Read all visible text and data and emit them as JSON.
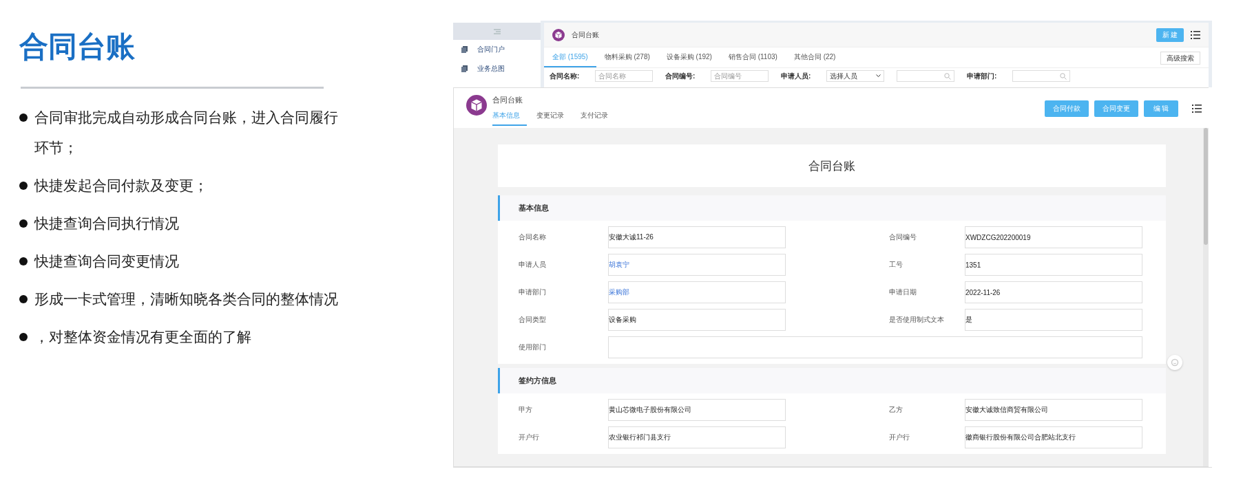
{
  "slide": {
    "title": "合同台账",
    "bullets": [
      {
        "text": "合同审批完成自动形成合同台账，进入合同履行环节；"
      },
      {
        "text": "快捷发起合同付款及变更；"
      },
      {
        "text": "快捷查询合同执行情况"
      },
      {
        "text": "快捷查询合同变更情况"
      },
      {
        "text": "形成一卡式管理，清晰知晓各类合同的整体情况"
      },
      {
        "text": "，对整体资金情况有更全面的了解"
      }
    ]
  },
  "background_app": {
    "sidebar": {
      "items": [
        {
          "label": "合同门户"
        },
        {
          "label": "业务总图"
        }
      ]
    },
    "title": "合同台账",
    "new_button": "新 建",
    "tabs": [
      {
        "label": "全部 (1595)",
        "selected": true
      },
      {
        "label": "物料采购 (278)",
        "selected": false
      },
      {
        "label": "设备采购 (192)",
        "selected": false
      },
      {
        "label": "销售合同 (1103)",
        "selected": false
      },
      {
        "label": "其他合同 (22)",
        "selected": false
      }
    ],
    "advanced_search": "高级搜索",
    "filters": [
      {
        "kind": "text",
        "label": "合同名称:",
        "placeholder": "合同名称"
      },
      {
        "kind": "text",
        "label": "合同编号:",
        "placeholder": "合同编号"
      },
      {
        "kind": "select",
        "label": "申请人员:",
        "value": "选择人员"
      },
      {
        "kind": "search"
      },
      {
        "kind": "search",
        "label": "申请部门:"
      }
    ]
  },
  "detail_window": {
    "title": "合同台账",
    "tabs": [
      {
        "label": "基本信息",
        "selected": true
      },
      {
        "label": "变更记录",
        "selected": false
      },
      {
        "label": "支付记录",
        "selected": false
      }
    ],
    "buttons": [
      "合同付款",
      "合同变更",
      "编 辑"
    ],
    "document_title": "合同台账",
    "sections": [
      {
        "title": "基本信息",
        "fields": [
          {
            "label": "合同名称",
            "value": "安徽大诚11-26",
            "link": false,
            "wide": false
          },
          {
            "label": "合同编号",
            "value": "XWDZCG202200019",
            "link": false,
            "wide": false
          },
          {
            "label": "申请人员",
            "value": "胡袁宁",
            "link": true,
            "wide": false
          },
          {
            "label": "工号",
            "value": "1351",
            "link": false,
            "wide": false
          },
          {
            "label": "申请部门",
            "value": "采购部",
            "link": true,
            "wide": false
          },
          {
            "label": "申请日期",
            "value": "2022-11-26",
            "link": false,
            "wide": false
          },
          {
            "label": "合同类型",
            "value": "设备采购",
            "link": false,
            "wide": false
          },
          {
            "label": "是否使用制式文本",
            "value": "是",
            "link": false,
            "wide": false
          },
          {
            "label": "使用部门",
            "link": false,
            "wide": true
          }
        ]
      },
      {
        "title": "签约方信息",
        "fields": [
          {
            "label": "甲方",
            "value": "黄山芯微电子股份有限公司",
            "link": false,
            "wide": false
          },
          {
            "label": "乙方",
            "value": "安徽大诚致信商贸有限公司",
            "link": false,
            "wide": false
          },
          {
            "label": "开户行",
            "value": "农业银行祁门县支行",
            "link": false,
            "wide": false
          },
          {
            "label": "开户行",
            "value": "徽商银行股份有限公司合肥站北支行",
            "link": false,
            "wide": false
          }
        ]
      }
    ]
  }
}
